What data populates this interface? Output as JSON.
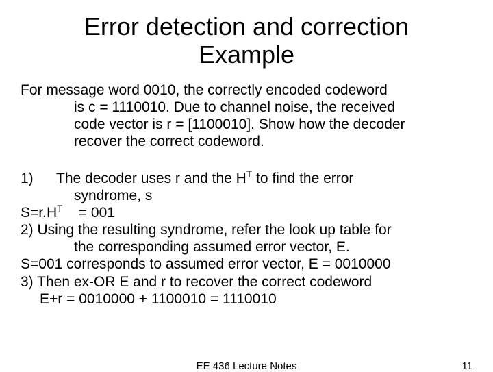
{
  "title_line1": "Error detection and correction",
  "title_line2": "Example",
  "problem": {
    "l1": "For message word 0010, the correctly encoded codeword",
    "l2": "is c = 1110010. Due to channel noise, the received",
    "l3": "code vector is r = [1100010]. Show how the decoder",
    "l4": "recover the correct codeword."
  },
  "steps": {
    "s1_num": "1)",
    "s1a": "The decoder uses r and the H",
    "s1a_sup": "T",
    "s1a_tail": " to find the error",
    "s1b": "syndrome, s",
    "s2a": "S=r.H",
    "s2a_sup": "T",
    "s2a_tail": "    = 001",
    "s3": "2) Using the resulting syndrome, refer the look up table for",
    "s3b": "the corresponding assumed error vector, E.",
    "s4": "S=001 corresponds to assumed error vector, E = 0010000",
    "s5": "3) Then ex-OR E and r to recover the correct codeword",
    "s6": "E+r = 0010000 + 1100010 = 1110010"
  },
  "footer": {
    "center": "EE 436 Lecture Notes",
    "page": "11"
  }
}
